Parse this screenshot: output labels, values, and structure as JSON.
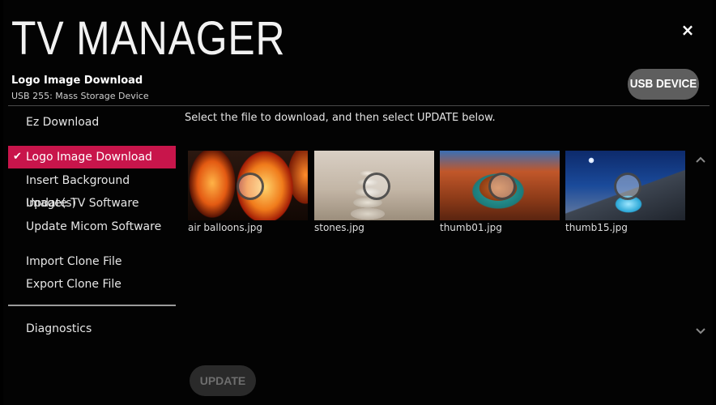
{
  "app": {
    "title": "TV MANAGER",
    "close_icon": "×",
    "section_title": "Logo Image Download",
    "device_name": "USB 255: Mass Storage Device",
    "usb_button": "USB DEVICE"
  },
  "sidebar": {
    "items": [
      {
        "label": "Ez Download",
        "active": false
      },
      {
        "label": "Logo Image Download",
        "active": true
      },
      {
        "label": "Insert Background Image(s)",
        "active": false
      },
      {
        "label": "Update TV Software",
        "active": false
      },
      {
        "label": "Update Micom Software",
        "active": false
      },
      {
        "label": "Import Clone File",
        "active": false
      },
      {
        "label": "Export Clone File",
        "active": false
      },
      {
        "label": "Diagnostics",
        "active": false
      }
    ],
    "check_icon": "✔"
  },
  "main": {
    "instruction": "Select the file to download, and then select UPDATE below.",
    "files": [
      {
        "name": "air balloons.jpg",
        "thumb": "hot-air-balloons"
      },
      {
        "name": "stones.jpg",
        "thumb": "stacked-stones"
      },
      {
        "name": "thumb01.jpg",
        "thumb": "horseshoe-canyon"
      },
      {
        "name": "thumb15.jpg",
        "thumb": "tent-night-sky"
      }
    ],
    "scroll_up_icon": "chevron-up-icon",
    "scroll_down_icon": "chevron-down-icon",
    "update_button": "UPDATE"
  },
  "colors": {
    "accent": "#c8154b",
    "background": "#030303",
    "button_bg": "#5e5e5e",
    "disabled_button_bg": "#2a2a2a"
  }
}
